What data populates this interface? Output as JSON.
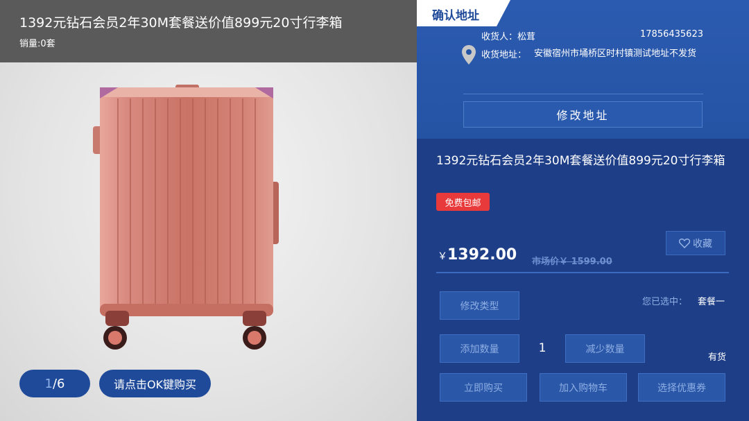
{
  "product": {
    "title": "1392元钻石会员2年30M套餐送价值899元20寸行李箱",
    "sales": "销量:0套",
    "pager_current": "1",
    "pager_total": "/6",
    "buy_hint": "请点击OK键购买"
  },
  "address": {
    "tab_label": "确认地址",
    "receiver": "收货人：松茸",
    "phone": "17856435623",
    "label": "收货地址：",
    "value": "安徽宿州市埇桥区时村镇测试地址不发货",
    "edit_button": "修改地址"
  },
  "detail": {
    "title": "1392元钻石会员2年30M套餐送价值899元20寸行李箱",
    "free_shipping": "免费包邮",
    "favorite": "收藏",
    "price_symbol": "￥",
    "price": "1392.00",
    "market_price": "市场价￥ 1599.00",
    "modify_type": "修改类型",
    "selected_label": "您已选中：",
    "selected_value": "套餐一",
    "add_qty": "添加数量",
    "quantity": "1",
    "reduce_qty": "减少数量",
    "stock": "有货",
    "buy_now": "立即购买",
    "add_cart": "加入购物车",
    "coupon": "选择优惠券"
  },
  "colors": {
    "accent": "#1f4a9a",
    "panel": "#1e3f88",
    "badge": "#e83a3a"
  },
  "icons": [
    "location-pin-icon",
    "heart-icon"
  ]
}
